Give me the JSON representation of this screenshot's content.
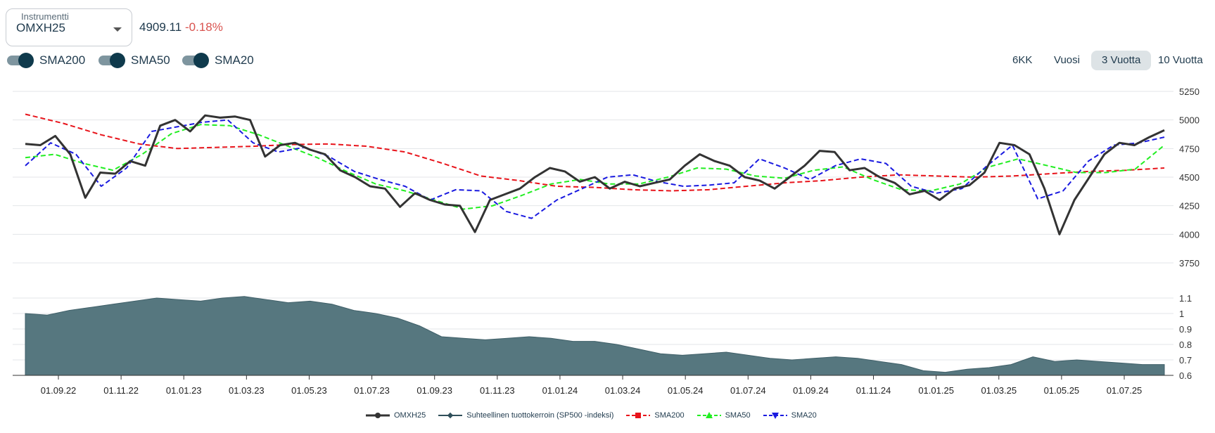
{
  "instrument": {
    "legend": "Instrumentti",
    "value": "OMXH25",
    "price": "4909.11",
    "change": "-0.18%"
  },
  "toggles": [
    {
      "label": "SMA200",
      "on": true
    },
    {
      "label": "SMA50",
      "on": true
    },
    {
      "label": "SMA20",
      "on": true
    }
  ],
  "ranges": [
    {
      "label": "6KK",
      "active": false
    },
    {
      "label": "Vuosi",
      "active": false
    },
    {
      "label": "3 Vuotta",
      "active": true
    },
    {
      "label": "10 Vuotta",
      "active": false
    }
  ],
  "colors": {
    "price": "#333333",
    "relative_fill": "#56777f",
    "sma200": "#e8141b",
    "sma50": "#22ee22",
    "sma20": "#1a1ae0",
    "negative": "#d9534f"
  },
  "chart_data": [
    {
      "type": "line",
      "x_categories": [
        "01.09.22",
        "01.11.22",
        "01.01.23",
        "01.03.23",
        "01.05.23",
        "01.07.23",
        "01.09.23",
        "01.11.23",
        "01.01.24",
        "01.03.24",
        "01.05.24",
        "01.07.24",
        "01.09.24",
        "01.11.24",
        "01.01.25",
        "01.03.25",
        "01.05.25",
        "01.07.25"
      ],
      "yticks": [
        "3750",
        "4000",
        "4250",
        "4500",
        "4750",
        "5000",
        "5250"
      ],
      "ylim": [
        3750,
        5250
      ],
      "series": [
        {
          "name": "OMXH25",
          "marker": "circle",
          "values": [
            4790,
            4780,
            4860,
            4700,
            4320,
            4540,
            4530,
            4640,
            4600,
            4950,
            5000,
            4900,
            5040,
            5020,
            5030,
            5000,
            4680,
            4780,
            4800,
            4740,
            4700,
            4560,
            4500,
            4420,
            4400,
            4240,
            4360,
            4300,
            4260,
            4250,
            4020,
            4300,
            4350,
            4400,
            4500,
            4580,
            4550,
            4460,
            4500,
            4400,
            4460,
            4420,
            4450,
            4480,
            4600,
            4700,
            4640,
            4600,
            4500,
            4470,
            4400,
            4500,
            4600,
            4730,
            4720,
            4560,
            4580,
            4500,
            4450,
            4350,
            4380,
            4300,
            4400,
            4430,
            4540,
            4800,
            4780,
            4700,
            4400,
            4000,
            4300,
            4500,
            4700,
            4800,
            4780,
            4850,
            4910
          ]
        },
        {
          "name": "SMA200",
          "marker": "square",
          "values": [
            5050,
            4970,
            4870,
            4790,
            4750,
            4760,
            4770,
            4785,
            4790,
            4770,
            4720,
            4620,
            4510,
            4470,
            4420,
            4410,
            4390,
            4380,
            4390,
            4420,
            4450,
            4470,
            4500,
            4520,
            4510,
            4500,
            4510,
            4530,
            4550,
            4560,
            4580
          ]
        },
        {
          "name": "SMA50",
          "marker": "triangle",
          "values": [
            4670,
            4700,
            4620,
            4560,
            4700,
            4880,
            4960,
            4950,
            4870,
            4770,
            4670,
            4550,
            4440,
            4380,
            4300,
            4220,
            4250,
            4340,
            4440,
            4480,
            4440,
            4440,
            4500,
            4580,
            4570,
            4510,
            4490,
            4560,
            4590,
            4480,
            4390,
            4380,
            4440,
            4590,
            4660,
            4600,
            4540,
            4540,
            4570,
            4780
          ]
        },
        {
          "name": "SMA20",
          "marker": "triangle-down",
          "values": [
            4600,
            4800,
            4700,
            4420,
            4580,
            4900,
            4940,
            4980,
            5000,
            4800,
            4720,
            4760,
            4680,
            4550,
            4480,
            4420,
            4300,
            4390,
            4380,
            4200,
            4140,
            4300,
            4400,
            4500,
            4520,
            4460,
            4420,
            4430,
            4450,
            4660,
            4580,
            4480,
            4600,
            4660,
            4620,
            4420,
            4360,
            4400,
            4600,
            4780,
            4310,
            4380,
            4640,
            4780,
            4800,
            4850
          ]
        }
      ]
    },
    {
      "type": "area",
      "name": "Suhteellinen tuottokerroin (SP500 -indeksi)",
      "yticks": [
        "0.6",
        "0.7",
        "0.8",
        "0.9",
        "1",
        "1.1"
      ],
      "ylim": [
        0.6,
        1.1
      ],
      "values": [
        1.0,
        0.99,
        1.02,
        1.04,
        1.06,
        1.08,
        1.1,
        1.09,
        1.08,
        1.1,
        1.11,
        1.09,
        1.07,
        1.08,
        1.06,
        1.02,
        1.0,
        0.97,
        0.92,
        0.85,
        0.84,
        0.83,
        0.84,
        0.85,
        0.84,
        0.82,
        0.82,
        0.8,
        0.77,
        0.74,
        0.73,
        0.74,
        0.75,
        0.73,
        0.71,
        0.7,
        0.71,
        0.72,
        0.71,
        0.69,
        0.67,
        0.63,
        0.62,
        0.64,
        0.65,
        0.67,
        0.72,
        0.69,
        0.7,
        0.69,
        0.68,
        0.67,
        0.67
      ]
    }
  ],
  "legend": [
    {
      "label": "OMXH25"
    },
    {
      "label": "Suhteellinen tuottokerroin (SP500 -indeksi)"
    },
    {
      "label": "SMA200"
    },
    {
      "label": "SMA50"
    },
    {
      "label": "SMA20"
    }
  ]
}
